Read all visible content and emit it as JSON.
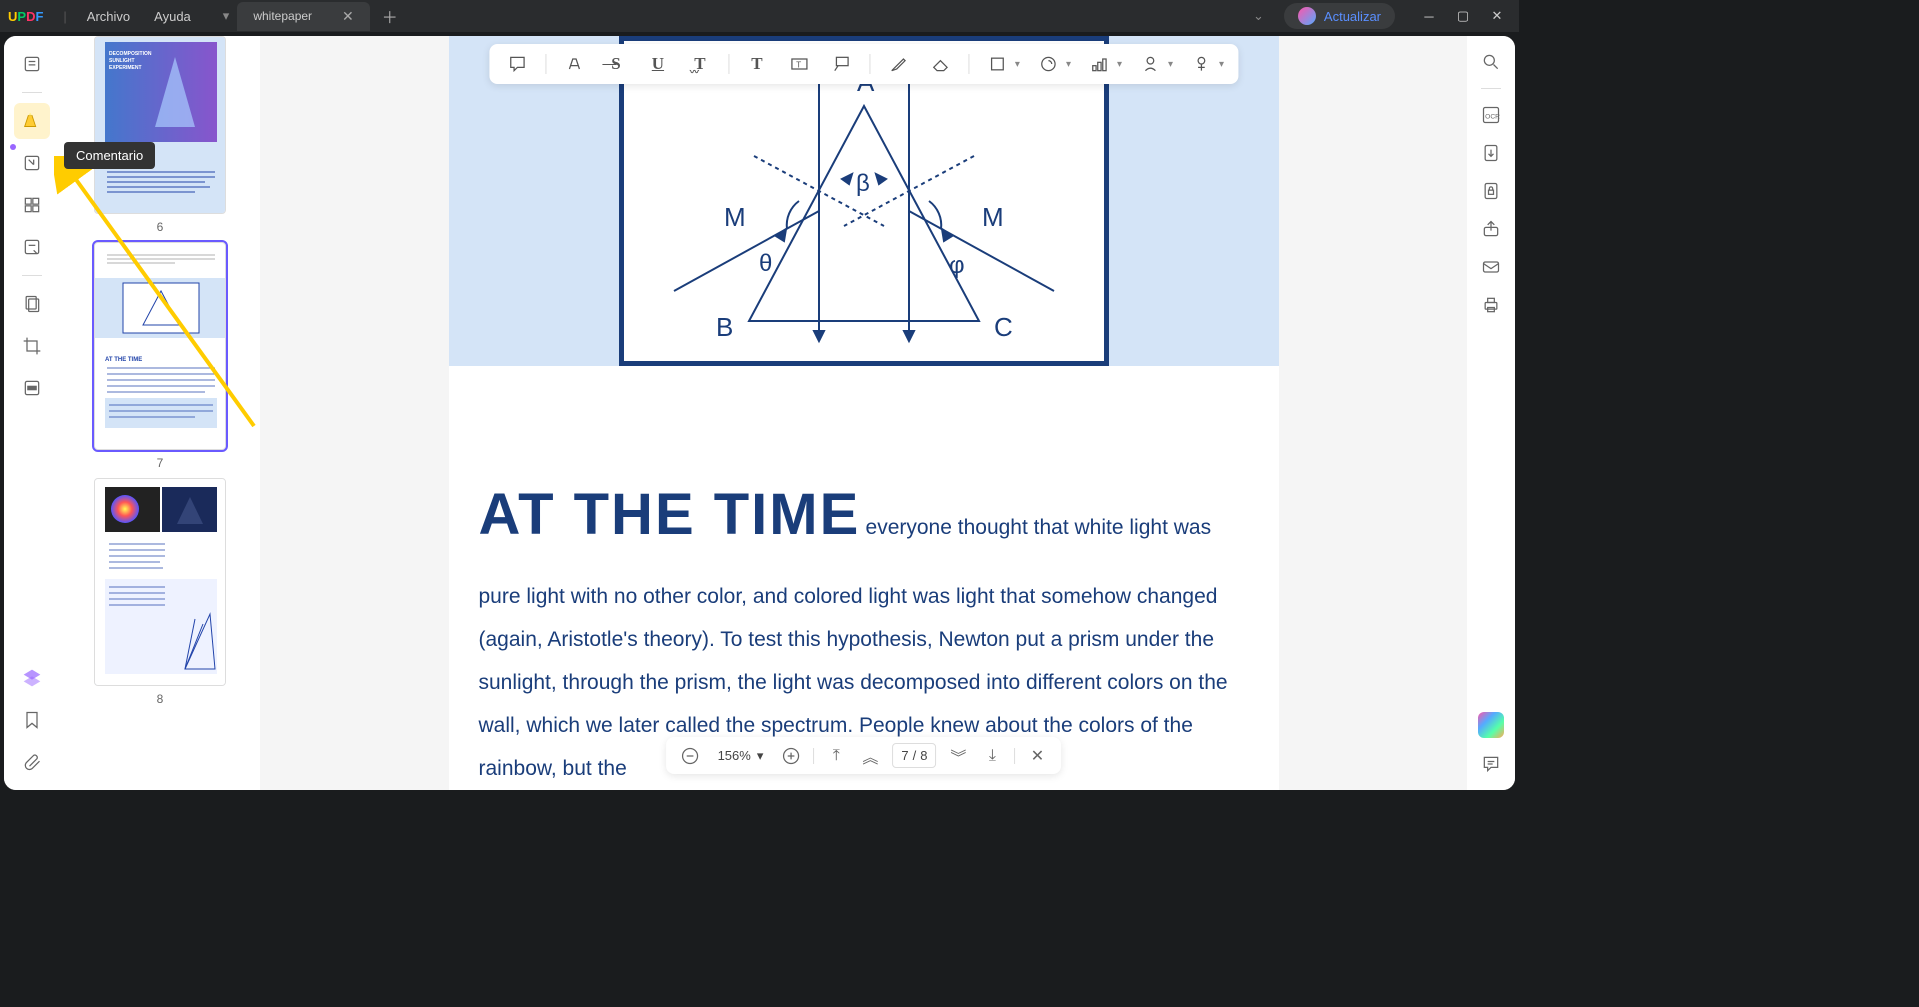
{
  "titlebar": {
    "logo": {
      "u": "U",
      "p": "P",
      "d": "D",
      "f": "F"
    },
    "menu": {
      "archivo": "Archivo",
      "ayuda": "Ayuda"
    },
    "tab_name": "whitepaper",
    "user_label": "Actualizar"
  },
  "tooltip": "Comentario",
  "thumbnails": [
    {
      "num": "6"
    },
    {
      "num": "7"
    },
    {
      "num": "8"
    }
  ],
  "zoom": "156%",
  "page_current": "7",
  "page_total": "8",
  "diagram": {
    "A": "A",
    "B": "B",
    "C": "C",
    "M1": "M",
    "M2": "M",
    "beta": "β",
    "theta": "θ",
    "phi": "φ"
  },
  "body": {
    "dropcap": "AT THE TIME",
    "text": "everyone thought that white light was pure light with no other color, and colored light was light that somehow changed (again, Aristotle's theory). To test this hypothesis, Newton put a prism under the sunlight, through the prism, the light was decomposed into different colors on the wall, which we later called the spectrum. People knew about the colors of the rainbow, but the"
  }
}
